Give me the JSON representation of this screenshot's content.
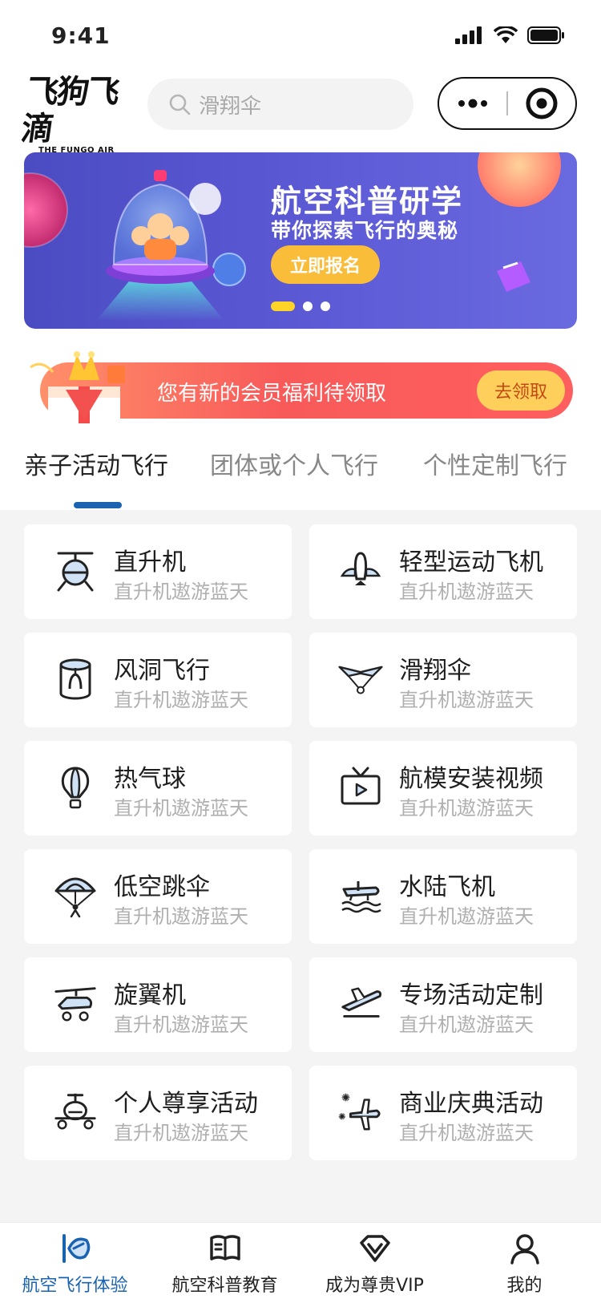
{
  "status_bar": {
    "time": "9:41"
  },
  "header": {
    "logo_main": "飞狗飞滴",
    "logo_sub": "THE FUNGO AIR TAXI",
    "search_placeholder": "滑翔伞"
  },
  "banner": {
    "title": "航空科普研学",
    "subtitle": "带你探索飞行的奥秘",
    "button_label": "立即报名",
    "dots": 3,
    "active_dot": 0
  },
  "member": {
    "text": "您有新的会员福利待领取",
    "button_label": "去领取"
  },
  "tabs": [
    {
      "label": "亲子活动飞行",
      "active": true
    },
    {
      "label": "团体或个人飞行",
      "active": false
    },
    {
      "label": "个性定制飞行",
      "active": false
    }
  ],
  "cards": [
    {
      "title": "直升机",
      "subtitle": "直升机遨游蓝天",
      "icon": "helicopter-icon"
    },
    {
      "title": "轻型运动飞机",
      "subtitle": "直升机遨游蓝天",
      "icon": "light-aircraft-icon"
    },
    {
      "title": "风洞飞行",
      "subtitle": "直升机遨游蓝天",
      "icon": "wind-tunnel-icon"
    },
    {
      "title": "滑翔伞",
      "subtitle": "直升机遨游蓝天",
      "icon": "paraglider-icon"
    },
    {
      "title": "热气球",
      "subtitle": "直升机遨游蓝天",
      "icon": "hot-air-balloon-icon"
    },
    {
      "title": "航模安装视频",
      "subtitle": "直升机遨游蓝天",
      "icon": "tv-video-icon"
    },
    {
      "title": "低空跳伞",
      "subtitle": "直升机遨游蓝天",
      "icon": "parachute-icon"
    },
    {
      "title": "水陆飞机",
      "subtitle": "直升机遨游蓝天",
      "icon": "seaplane-icon"
    },
    {
      "title": "旋翼机",
      "subtitle": "直升机遨游蓝天",
      "icon": "gyroplane-icon"
    },
    {
      "title": "专场活动定制",
      "subtitle": "直升机遨游蓝天",
      "icon": "plane-takeoff-icon"
    },
    {
      "title": "个人尊享活动",
      "subtitle": "直升机遨游蓝天",
      "icon": "drone-icon"
    },
    {
      "title": "商业庆典活动",
      "subtitle": "直升机遨游蓝天",
      "icon": "celebration-plane-icon"
    }
  ],
  "bottom_nav": [
    {
      "label": "航空飞行体验",
      "active": true,
      "icon": "flight-experience-icon"
    },
    {
      "label": "航空科普教育",
      "active": false,
      "icon": "book-icon"
    },
    {
      "label": "成为尊贵VIP",
      "active": false,
      "icon": "vip-icon"
    },
    {
      "label": "我的",
      "active": false,
      "icon": "user-icon"
    }
  ],
  "colors": {
    "accent": "#1a63b0",
    "banner_bg": "#5a57d3",
    "member_bg": "#f85a5a",
    "member_button": "#ffcf5c",
    "grid_bg": "#f4f4f4"
  }
}
